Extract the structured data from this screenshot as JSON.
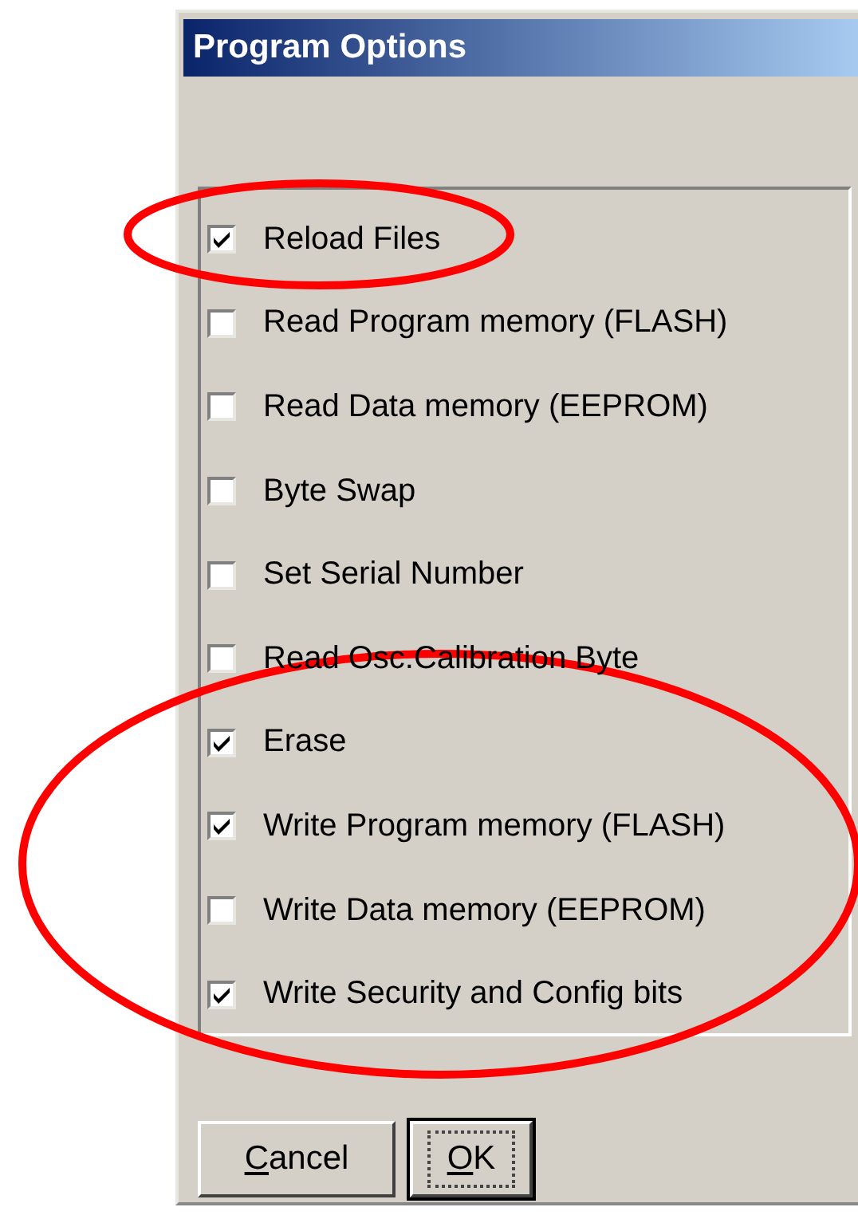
{
  "window": {
    "title": "Program Options"
  },
  "options": [
    {
      "label": "Reload Files",
      "checked": true
    },
    {
      "label": "Read Program memory (FLASH)",
      "checked": false
    },
    {
      "label": "Read Data memory (EEPROM)",
      "checked": false
    },
    {
      "label": "Byte Swap",
      "checked": false
    },
    {
      "label": "Set Serial Number",
      "checked": false
    },
    {
      "label": "Read Osc.Calibration Byte",
      "checked": false
    },
    {
      "label": "Erase",
      "checked": true
    },
    {
      "label": "Write Program memory (FLASH)",
      "checked": true
    },
    {
      "label": "Write Data memory (EEPROM)",
      "checked": false
    },
    {
      "label": "Write Security and Config bits",
      "checked": true
    }
  ],
  "buttons": [
    {
      "accel": "C",
      "rest": "ancel",
      "default": false
    },
    {
      "accel": "O",
      "rest": "K",
      "default": true
    }
  ]
}
